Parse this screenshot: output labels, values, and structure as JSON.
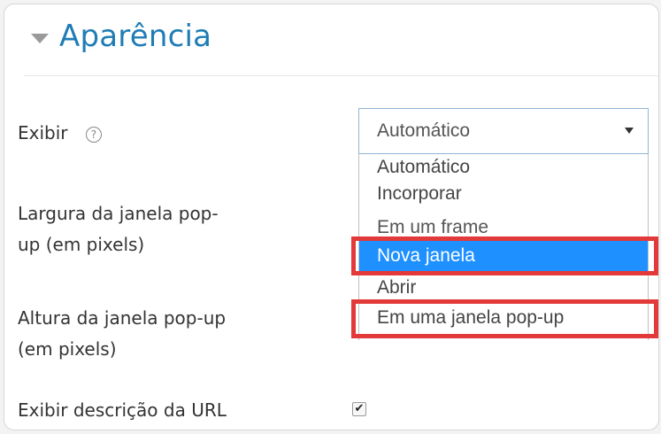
{
  "section": {
    "title": "Aparência"
  },
  "fields": {
    "display_label": "Exibir",
    "width_label_line1": "Largura da janela pop-",
    "width_label_line2": "up (em pixels)",
    "height_label_line1": "Altura da janela pop-up",
    "height_label_line2": "(em pixels)",
    "show_desc_label": "Exibir descrição da URL"
  },
  "select": {
    "value": "Automático",
    "options": [
      "Automático",
      "Incorporar",
      "Em um frame",
      "Nova janela",
      "Abrir",
      "Em uma janela pop-up"
    ],
    "selected_option": "Nova janela"
  },
  "icons": {
    "help": "help-icon",
    "caret": "caret-down-icon",
    "dropdown_arrow": "dropdown-arrow-icon",
    "checkmark": "✔"
  },
  "checkbox": {
    "checked": true
  },
  "colors": {
    "title": "#1f7cb5",
    "selected_bg": "#1e90ff",
    "highlight": "#e23a3a"
  }
}
